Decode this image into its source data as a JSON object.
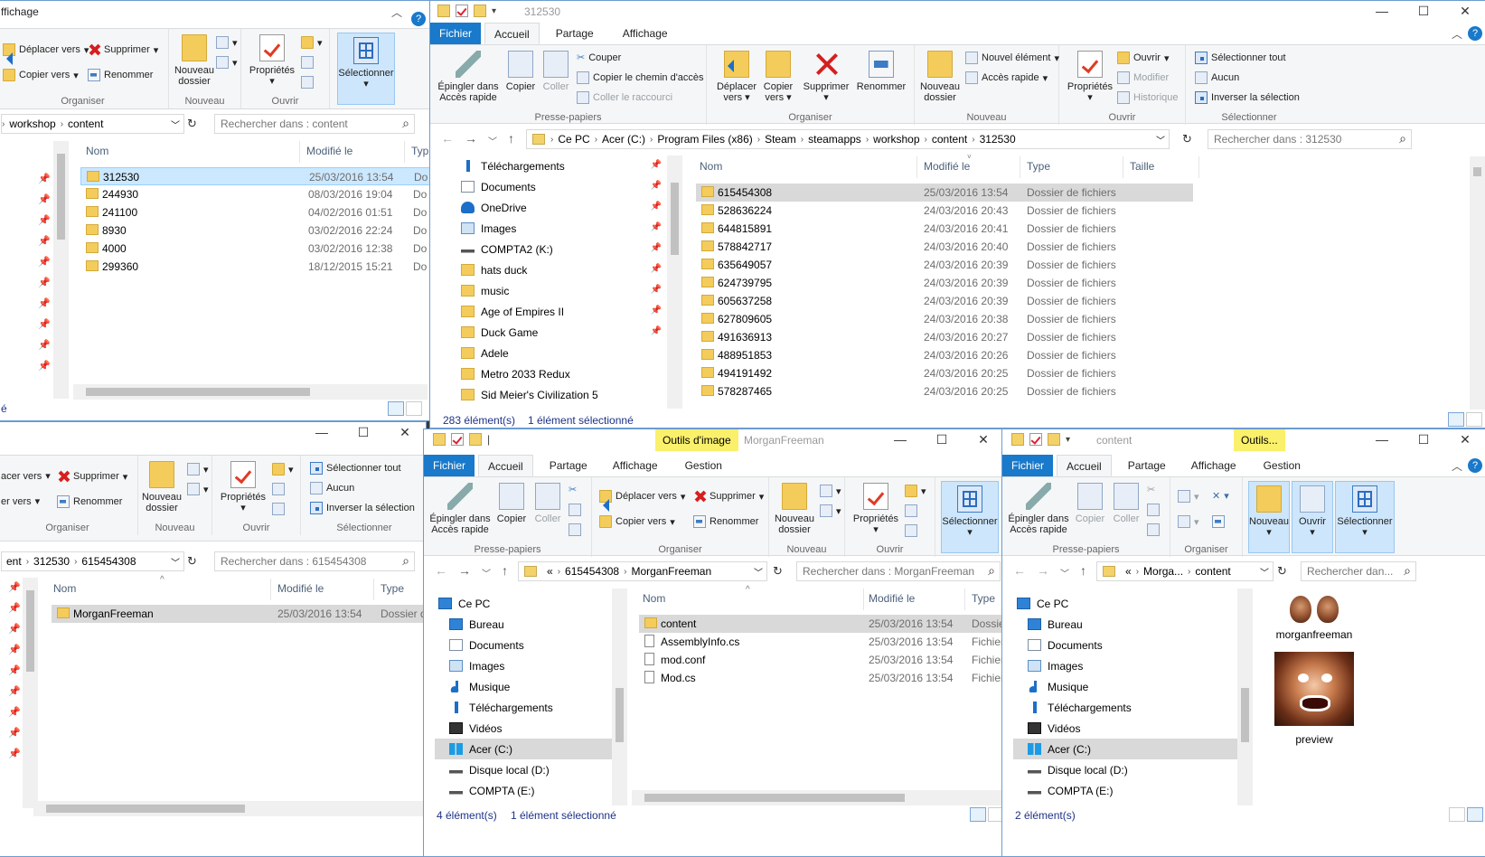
{
  "w1": {
    "title": "ffichage",
    "ribbon": {
      "organiser": {
        "move": "Déplacer vers",
        "copy": "Copier vers",
        "delete": "Supprimer",
        "rename": "Renommer",
        "label": "Organiser"
      },
      "nouveau": {
        "new_folder": "Nouveau dossier",
        "label": "Nouveau"
      },
      "ouvrir": {
        "properties": "Propriétés",
        "label": "Ouvrir"
      },
      "select": {
        "select": "Sélectionner"
      }
    },
    "address": [
      "workshop",
      "content"
    ],
    "search_placeholder": "Rechercher dans : content",
    "columns": {
      "name": "Nom",
      "modified": "Modifié le",
      "type": "Typ"
    },
    "rows": [
      {
        "name": "312530",
        "date": "25/03/2016 13:54",
        "type": "Do"
      },
      {
        "name": "244930",
        "date": "08/03/2016 19:04",
        "type": "Do"
      },
      {
        "name": "241100",
        "date": "04/02/2016 01:51",
        "type": "Do"
      },
      {
        "name": "8930",
        "date": "03/02/2016 22:24",
        "type": "Do"
      },
      {
        "name": "4000",
        "date": "03/02/2016 12:38",
        "type": "Do"
      },
      {
        "name": "299360",
        "date": "18/12/2015 15:21",
        "type": "Do"
      }
    ],
    "status_fragment": "é"
  },
  "w2": {
    "title": "312530",
    "tabs": {
      "file": "Fichier",
      "home": "Accueil",
      "share": "Partage",
      "view": "Affichage"
    },
    "ribbon": {
      "pin": "Épingler dans Accès rapide",
      "copy": "Copier",
      "paste": "Coller",
      "cut": "Couper",
      "copy_path": "Copier le chemin d'accès",
      "paste_shortcut": "Coller le raccourci",
      "clipboard_label": "Presse-papiers",
      "move": "Déplacer vers",
      "copy_to": "Copier vers",
      "delete": "Supprimer",
      "rename": "Renommer",
      "organiser_label": "Organiser",
      "new_folder": "Nouveau dossier",
      "new_item": "Nouvel élément",
      "quick_access": "Accès rapide",
      "nouveau_label": "Nouveau",
      "properties": "Propriétés",
      "open": "Ouvrir",
      "edit": "Modifier",
      "history": "Historique",
      "ouvrir_label": "Ouvrir",
      "select_all": "Sélectionner tout",
      "select_none": "Aucun",
      "invert": "Inverser la sélection",
      "select_label": "Sélectionner"
    },
    "address": [
      "Ce PC",
      "Acer (C:)",
      "Program Files (x86)",
      "Steam",
      "steamapps",
      "workshop",
      "content",
      "312530"
    ],
    "search_placeholder": "Rechercher dans : 312530",
    "nav": [
      {
        "label": "Téléchargements",
        "icon": "download-icon"
      },
      {
        "label": "Documents",
        "icon": "documents-icon"
      },
      {
        "label": "OneDrive",
        "icon": "onedrive-icon"
      },
      {
        "label": "Images",
        "icon": "images-icon"
      },
      {
        "label": "COMPTA2 (K:)",
        "icon": "drive-icon"
      },
      {
        "label": "hats duck",
        "icon": "folder-icon"
      },
      {
        "label": "music",
        "icon": "folder-icon"
      },
      {
        "label": "Age of Empires II",
        "icon": "folder-icon"
      },
      {
        "label": "Duck Game",
        "icon": "folder-icon"
      },
      {
        "label": "Adele",
        "icon": "folder-icon"
      },
      {
        "label": "Metro 2033 Redux",
        "icon": "folder-icon"
      },
      {
        "label": "Sid Meier's Civilization 5",
        "icon": "folder-icon"
      }
    ],
    "columns": {
      "name": "Nom",
      "modified": "Modifié le",
      "type": "Type",
      "size": "Taille"
    },
    "rows": [
      {
        "name": "615454308",
        "date": "25/03/2016 13:54",
        "type": "Dossier de fichiers"
      },
      {
        "name": "528636224",
        "date": "24/03/2016 20:43",
        "type": "Dossier de fichiers"
      },
      {
        "name": "644815891",
        "date": "24/03/2016 20:41",
        "type": "Dossier de fichiers"
      },
      {
        "name": "578842717",
        "date": "24/03/2016 20:40",
        "type": "Dossier de fichiers"
      },
      {
        "name": "635649057",
        "date": "24/03/2016 20:39",
        "type": "Dossier de fichiers"
      },
      {
        "name": "624739795",
        "date": "24/03/2016 20:39",
        "type": "Dossier de fichiers"
      },
      {
        "name": "605637258",
        "date": "24/03/2016 20:39",
        "type": "Dossier de fichiers"
      },
      {
        "name": "627809605",
        "date": "24/03/2016 20:38",
        "type": "Dossier de fichiers"
      },
      {
        "name": "491636913",
        "date": "24/03/2016 20:27",
        "type": "Dossier de fichiers"
      },
      {
        "name": "488951853",
        "date": "24/03/2016 20:26",
        "type": "Dossier de fichiers"
      },
      {
        "name": "494191492",
        "date": "24/03/2016 20:25",
        "type": "Dossier de fichiers"
      },
      {
        "name": "578287465",
        "date": "24/03/2016 20:25",
        "type": "Dossier de fichiers"
      }
    ],
    "status": {
      "count": "283 élément(s)",
      "selected": "1 élément sélectionné"
    }
  },
  "w3": {
    "ribbon": {
      "move": "acer vers",
      "copy": "er vers",
      "delete": "Supprimer",
      "rename": "Renommer",
      "organiser_label": "Organiser",
      "new_folder": "Nouveau dossier",
      "nouveau_label": "Nouveau",
      "properties": "Propriétés",
      "ouvrir_label": "Ouvrir",
      "select_all": "Sélectionner tout",
      "select_none": "Aucun",
      "invert": "Inverser la sélection",
      "select_label": "Sélectionner"
    },
    "address": [
      "ent",
      "312530",
      "615454308"
    ],
    "search_placeholder": "Rechercher dans : 615454308",
    "columns": {
      "name": "Nom",
      "modified": "Modifié le",
      "type": "Type"
    },
    "rows": [
      {
        "name": "MorganFreeman",
        "date": "25/03/2016 13:54",
        "type": "Dossier d"
      }
    ]
  },
  "w4": {
    "title": "MorganFreeman",
    "context_tab": "Outils d'image",
    "tabs": {
      "file": "Fichier",
      "home": "Accueil",
      "share": "Partage",
      "view": "Affichage",
      "manage": "Gestion"
    },
    "ribbon": {
      "pin": "Épingler dans Accès rapide",
      "copy": "Copier",
      "paste": "Coller",
      "clipboard_label": "Presse-papiers",
      "move": "Déplacer vers",
      "copy_to": "Copier vers",
      "delete": "Supprimer",
      "rename": "Renommer",
      "organiser_label": "Organiser",
      "new_folder": "Nouveau dossier",
      "nouveau_label": "Nouveau",
      "properties": "Propriétés",
      "ouvrir_label": "Ouvrir",
      "select": "Sélectionner"
    },
    "address": [
      "«",
      "615454308",
      "MorganFreeman"
    ],
    "search_placeholder": "Rechercher dans : MorganFreeman",
    "nav": [
      {
        "label": "Ce PC",
        "icon": "computer-icon"
      },
      {
        "label": "Bureau",
        "icon": "desktop-icon"
      },
      {
        "label": "Documents",
        "icon": "documents-icon"
      },
      {
        "label": "Images",
        "icon": "images-icon"
      },
      {
        "label": "Musique",
        "icon": "music-icon"
      },
      {
        "label": "Téléchargements",
        "icon": "download-icon"
      },
      {
        "label": "Vidéos",
        "icon": "videos-icon"
      },
      {
        "label": "Acer (C:)",
        "icon": "windows-drive-icon"
      },
      {
        "label": "Disque local (D:)",
        "icon": "drive-icon"
      },
      {
        "label": "COMPTA (E:)",
        "icon": "drive-icon"
      }
    ],
    "columns": {
      "name": "Nom",
      "modified": "Modifié le",
      "type": "Type"
    },
    "rows": [
      {
        "name": "content",
        "date": "25/03/2016 13:54",
        "type": "Dossie",
        "kind": "folder"
      },
      {
        "name": "AssemblyInfo.cs",
        "date": "25/03/2016 13:54",
        "type": "Fichier",
        "kind": "file"
      },
      {
        "name": "mod.conf",
        "date": "25/03/2016 13:54",
        "type": "Fichier",
        "kind": "file"
      },
      {
        "name": "Mod.cs",
        "date": "25/03/2016 13:54",
        "type": "Fichier",
        "kind": "file"
      }
    ],
    "status": {
      "count": "4 élément(s)",
      "selected": "1 élément sélectionné"
    }
  },
  "w5": {
    "title": "content",
    "context_tab": "Outils...",
    "tabs": {
      "file": "Fichier",
      "home": "Accueil",
      "share": "Partage",
      "view": "Affichage",
      "manage": "Gestion"
    },
    "ribbon": {
      "pin": "Épingler dans Accès rapide",
      "copy": "Copier",
      "paste": "Coller",
      "clipboard_label": "Presse-papiers",
      "organiser_label": "Organiser",
      "new": "Nouveau",
      "open": "Ouvrir",
      "select": "Sélectionner"
    },
    "address": [
      "«",
      "Morga...",
      "content"
    ],
    "search_placeholder": "Rechercher dan...",
    "nav": [
      {
        "label": "Ce PC",
        "icon": "computer-icon"
      },
      {
        "label": "Bureau",
        "icon": "desktop-icon"
      },
      {
        "label": "Documents",
        "icon": "documents-icon"
      },
      {
        "label": "Images",
        "icon": "images-icon"
      },
      {
        "label": "Musique",
        "icon": "music-icon"
      },
      {
        "label": "Téléchargements",
        "icon": "download-icon"
      },
      {
        "label": "Vidéos",
        "icon": "videos-icon"
      },
      {
        "label": "Acer (C:)",
        "icon": "windows-drive-icon"
      },
      {
        "label": "Disque local (D:)",
        "icon": "drive-icon"
      },
      {
        "label": "COMPTA (E:)",
        "icon": "drive-icon"
      }
    ],
    "items": [
      {
        "name": "morganfreeman"
      },
      {
        "name": "preview"
      }
    ],
    "status": {
      "count": "2 élément(s)"
    }
  },
  "colors": {
    "accent": "#1979ca",
    "selection": "#cce8ff",
    "gray_selection": "#d9d9d9",
    "context": "#faf06b"
  }
}
